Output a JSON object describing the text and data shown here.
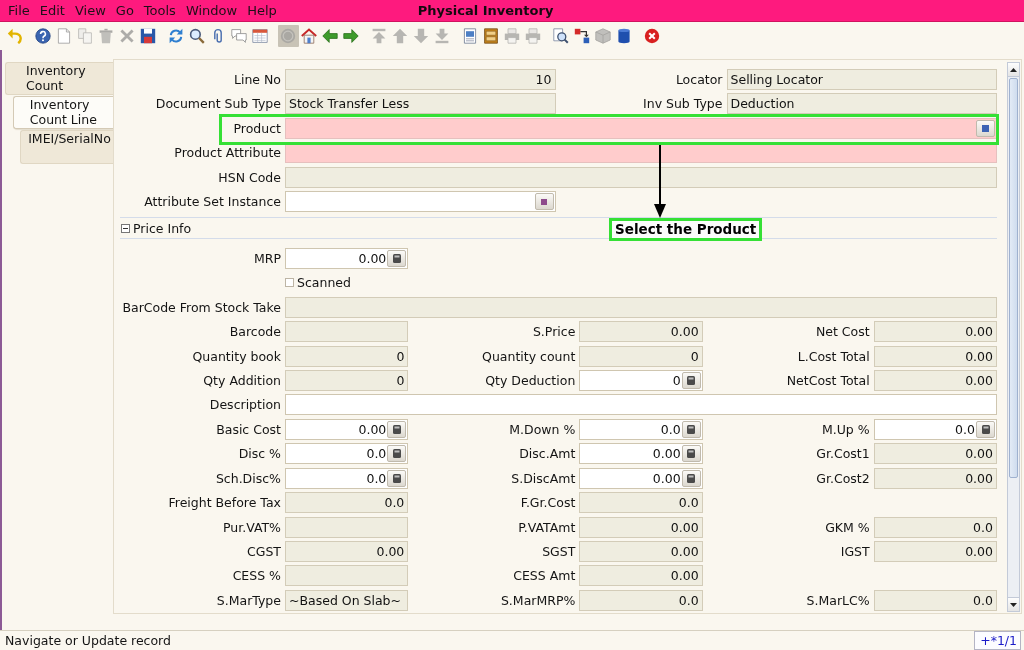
{
  "window": {
    "title": "Physical Inventory"
  },
  "menu": [
    "File",
    "Edit",
    "View",
    "Go",
    "Tools",
    "Window",
    "Help"
  ],
  "toolbar": [
    {
      "items": [
        {
          "kind": "undo",
          "disabled": false,
          "pressed": false
        }
      ]
    },
    {
      "items": [
        {
          "kind": "help",
          "disabled": false,
          "pressed": false
        },
        {
          "kind": "new",
          "disabled": false,
          "pressed": false
        },
        {
          "kind": "copy",
          "disabled": true,
          "pressed": false
        },
        {
          "kind": "delete",
          "disabled": true,
          "pressed": false
        },
        {
          "kind": "delete_selection",
          "disabled": true,
          "pressed": false
        },
        {
          "kind": "save",
          "disabled": false,
          "pressed": false
        }
      ]
    },
    {
      "items": [
        {
          "kind": "refresh",
          "disabled": false,
          "pressed": false
        },
        {
          "kind": "find",
          "disabled": false,
          "pressed": false
        },
        {
          "kind": "attachment",
          "disabled": false,
          "pressed": false
        },
        {
          "kind": "chat",
          "disabled": false,
          "pressed": false
        },
        {
          "kind": "grid_toggle",
          "disabled": false,
          "pressed": false
        }
      ]
    },
    {
      "items": [
        {
          "kind": "history",
          "disabled": true,
          "pressed": true
        },
        {
          "kind": "home",
          "disabled": false,
          "pressed": false
        },
        {
          "kind": "parent",
          "disabled": false,
          "pressed": false
        },
        {
          "kind": "detail",
          "disabled": false,
          "pressed": false
        }
      ]
    },
    {
      "items": [
        {
          "kind": "first",
          "disabled": true,
          "pressed": false
        },
        {
          "kind": "previous",
          "disabled": true,
          "pressed": false
        },
        {
          "kind": "next",
          "disabled": true,
          "pressed": false
        },
        {
          "kind": "last",
          "disabled": true,
          "pressed": false
        }
      ]
    },
    {
      "items": [
        {
          "kind": "report",
          "disabled": false,
          "pressed": false
        },
        {
          "kind": "archive",
          "disabled": false,
          "pressed": false
        },
        {
          "kind": "print_preview",
          "disabled": true,
          "pressed": false
        },
        {
          "kind": "print",
          "disabled": true,
          "pressed": false
        }
      ]
    },
    {
      "items": [
        {
          "kind": "zoom_across",
          "disabled": false,
          "pressed": false
        },
        {
          "kind": "workflow",
          "disabled": false,
          "pressed": false
        },
        {
          "kind": "request",
          "disabled": true,
          "pressed": false
        },
        {
          "kind": "product_info",
          "disabled": false,
          "pressed": false
        }
      ]
    },
    {
      "items": [
        {
          "kind": "end",
          "disabled": false,
          "pressed": false
        }
      ]
    }
  ],
  "tabs": [
    {
      "label": "Inventory Count",
      "selected": false,
      "children": [
        {
          "label": "Inventory Count Line",
          "selected": true,
          "children": [
            {
              "label": "IMEI/SerialNo",
              "selected": false
            }
          ]
        }
      ]
    }
  ],
  "header": {
    "rows": [
      {
        "kind": "columns",
        "fields": [
          {
            "label": "Line No",
            "value": "10",
            "kind": "number",
            "readonly": true,
            "mandatory": false
          },
          {
            "label": "Locator",
            "value": "Selling Locator",
            "kind": "text",
            "readonly": true,
            "mandatory": false
          }
        ]
      },
      {
        "kind": "columns",
        "fields": [
          {
            "label": "Document Sub Type",
            "value": "Stock Transfer Less",
            "kind": "text",
            "readonly": true,
            "mandatory": false
          },
          {
            "label": "Inv Sub Type",
            "value": "Deduction",
            "kind": "text",
            "readonly": true,
            "mandatory": false
          }
        ]
      },
      {
        "kind": "wide",
        "fields": [
          {
            "label": "Product",
            "kind": "text",
            "readonly": false,
            "mandatory": true,
            "button": {
              "kind": "lookup"
            }
          }
        ],
        "callout": {
          "text": "Select the Product"
        }
      },
      {
        "kind": "wide",
        "fields": [
          {
            "label": "Product Attribute",
            "kind": "text",
            "readonly": false,
            "mandatory": true
          }
        ]
      },
      {
        "kind": "wide",
        "fields": [
          {
            "label": "HSN Code",
            "kind": "text",
            "readonly": true,
            "mandatory": false
          }
        ]
      },
      {
        "kind": "columns",
        "fields": [
          {
            "label": "Attribute Set Instance",
            "kind": "text",
            "readonly": false,
            "mandatory": false,
            "button": {
              "kind": "attribute"
            }
          }
        ]
      }
    ]
  },
  "price_info": {
    "title": "Price Info",
    "expanded": true,
    "rows": [
      {
        "kind": "columns",
        "fields": [
          {
            "label": "MRP",
            "value": "0.00",
            "kind": "number",
            "readonly": false,
            "mandatory": false,
            "button": {
              "kind": "calculator"
            }
          }
        ]
      },
      {
        "kind": "checkbox",
        "label": "Scanned",
        "checked": false
      },
      {
        "kind": "wide",
        "fields": [
          {
            "label": "BarCode From Stock Take",
            "kind": "text",
            "readonly": true,
            "mandatory": false
          }
        ]
      },
      {
        "kind": "columns",
        "fields": [
          {
            "label": "Barcode",
            "kind": "text",
            "readonly": true,
            "mandatory": false
          },
          {
            "label": "S.Price",
            "value": "0.00",
            "kind": "number",
            "readonly": true,
            "mandatory": false
          },
          {
            "label": "Net Cost",
            "value": "0.00",
            "kind": "number",
            "readonly": true,
            "mandatory": false
          }
        ]
      },
      {
        "kind": "columns",
        "fields": [
          {
            "label": "Quantity book",
            "value": "0",
            "kind": "number",
            "readonly": true,
            "mandatory": false
          },
          {
            "label": "Quantity count",
            "value": "0",
            "kind": "number",
            "readonly": true,
            "mandatory": false
          },
          {
            "label": "L.Cost Total",
            "value": "0.00",
            "kind": "number",
            "readonly": true,
            "mandatory": false
          }
        ]
      },
      {
        "kind": "columns",
        "fields": [
          {
            "label": "Qty Addition",
            "value": "0",
            "kind": "number",
            "readonly": true,
            "mandatory": false
          },
          {
            "label": "Qty Deduction",
            "value": "0",
            "kind": "number",
            "readonly": false,
            "mandatory": false,
            "button": {
              "kind": "calculator"
            }
          },
          {
            "label": "NetCost Total",
            "value": "0.00",
            "kind": "number",
            "readonly": true,
            "mandatory": false
          }
        ]
      },
      {
        "kind": "wide",
        "fields": [
          {
            "label": "Description",
            "kind": "text",
            "readonly": false,
            "mandatory": false
          }
        ]
      },
      {
        "kind": "columns",
        "fields": [
          {
            "label": "Basic Cost",
            "value": "0.00",
            "kind": "number",
            "readonly": false,
            "mandatory": false,
            "button": {
              "kind": "calculator"
            }
          },
          {
            "label": "M.Down %",
            "value": "0.0",
            "kind": "number",
            "readonly": false,
            "mandatory": false,
            "button": {
              "kind": "calculator"
            }
          },
          {
            "label": "M.Up %",
            "value": "0.0",
            "kind": "number",
            "readonly": false,
            "mandatory": false,
            "button": {
              "kind": "calculator"
            }
          }
        ]
      },
      {
        "kind": "columns",
        "fields": [
          {
            "label": "Disc %",
            "value": "0.0",
            "kind": "number",
            "readonly": false,
            "mandatory": false,
            "button": {
              "kind": "calculator"
            }
          },
          {
            "label": "Disc.Amt",
            "value": "0.00",
            "kind": "number",
            "readonly": false,
            "mandatory": false,
            "button": {
              "kind": "calculator"
            }
          },
          {
            "label": "Gr.Cost1",
            "value": "0.00",
            "kind": "number",
            "readonly": true,
            "mandatory": false
          }
        ]
      },
      {
        "kind": "columns",
        "fields": [
          {
            "label": "Sch.Disc%",
            "value": "0.0",
            "kind": "number",
            "readonly": false,
            "mandatory": false,
            "button": {
              "kind": "calculator"
            }
          },
          {
            "label": "S.DiscAmt",
            "value": "0.00",
            "kind": "number",
            "readonly": false,
            "mandatory": false,
            "button": {
              "kind": "calculator"
            }
          },
          {
            "label": "Gr.Cost2",
            "value": "0.00",
            "kind": "number",
            "readonly": true,
            "mandatory": false
          }
        ]
      },
      {
        "kind": "columns",
        "fields": [
          {
            "label": "Freight Before Tax",
            "value": "0.0",
            "kind": "number",
            "readonly": true,
            "mandatory": false
          },
          {
            "label": "F.Gr.Cost",
            "value": "0.0",
            "kind": "number",
            "readonly": true,
            "mandatory": false
          }
        ]
      },
      {
        "kind": "columns",
        "fields": [
          {
            "label": "Pur.VAT%",
            "kind": "number",
            "readonly": true,
            "mandatory": false
          },
          {
            "label": "P.VATAmt",
            "value": "0.00",
            "kind": "number",
            "readonly": true,
            "mandatory": false
          },
          {
            "label": "GKM %",
            "value": "0.0",
            "kind": "number",
            "readonly": true,
            "mandatory": false
          }
        ]
      },
      {
        "kind": "columns",
        "fields": [
          {
            "label": "CGST",
            "value": "0.00",
            "kind": "number",
            "readonly": true,
            "mandatory": false
          },
          {
            "label": "SGST",
            "value": "0.00",
            "kind": "number",
            "readonly": true,
            "mandatory": false
          },
          {
            "label": "IGST",
            "value": "0.00",
            "kind": "number",
            "readonly": true,
            "mandatory": false
          }
        ]
      },
      {
        "kind": "columns",
        "fields": [
          {
            "label": "CESS %",
            "kind": "number",
            "readonly": true,
            "mandatory": false
          },
          {
            "label": "CESS Amt",
            "value": "0.00",
            "kind": "number",
            "readonly": true,
            "mandatory": false
          }
        ]
      },
      {
        "kind": "columns",
        "fields": [
          {
            "label": "S.MarType",
            "value": "~Based On Slab~",
            "kind": "text",
            "readonly": true,
            "mandatory": false
          },
          {
            "label": "S.MarMRP%",
            "value": "0.0",
            "kind": "number",
            "readonly": true,
            "mandatory": false
          },
          {
            "label": "S.MarLC%",
            "value": "0.0",
            "kind": "number",
            "readonly": true,
            "mandatory": false
          }
        ]
      }
    ]
  },
  "status_bar": {
    "message": "Navigate or Update record",
    "record": "+*1/1"
  }
}
